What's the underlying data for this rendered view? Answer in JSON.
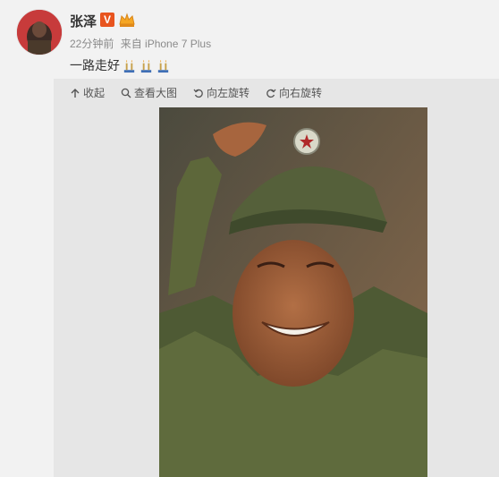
{
  "user": {
    "name": "张泽",
    "verified_badge": "V",
    "member_icon": "vip-crown-icon"
  },
  "meta": {
    "time": "22分钟前",
    "source": "来自 iPhone 7 Plus"
  },
  "post": {
    "text": "一路走好",
    "emojis": [
      "candle-icon",
      "candle-icon",
      "candle-icon"
    ]
  },
  "toolbar": {
    "collapse": "收起",
    "view_large": "查看大图",
    "rotate_left": "向左旋转",
    "rotate_right": "向右旋转"
  },
  "colors": {
    "badge": "#e8541e",
    "meta_text": "#8b8b8b",
    "panel_bg": "#e6e6e6"
  }
}
